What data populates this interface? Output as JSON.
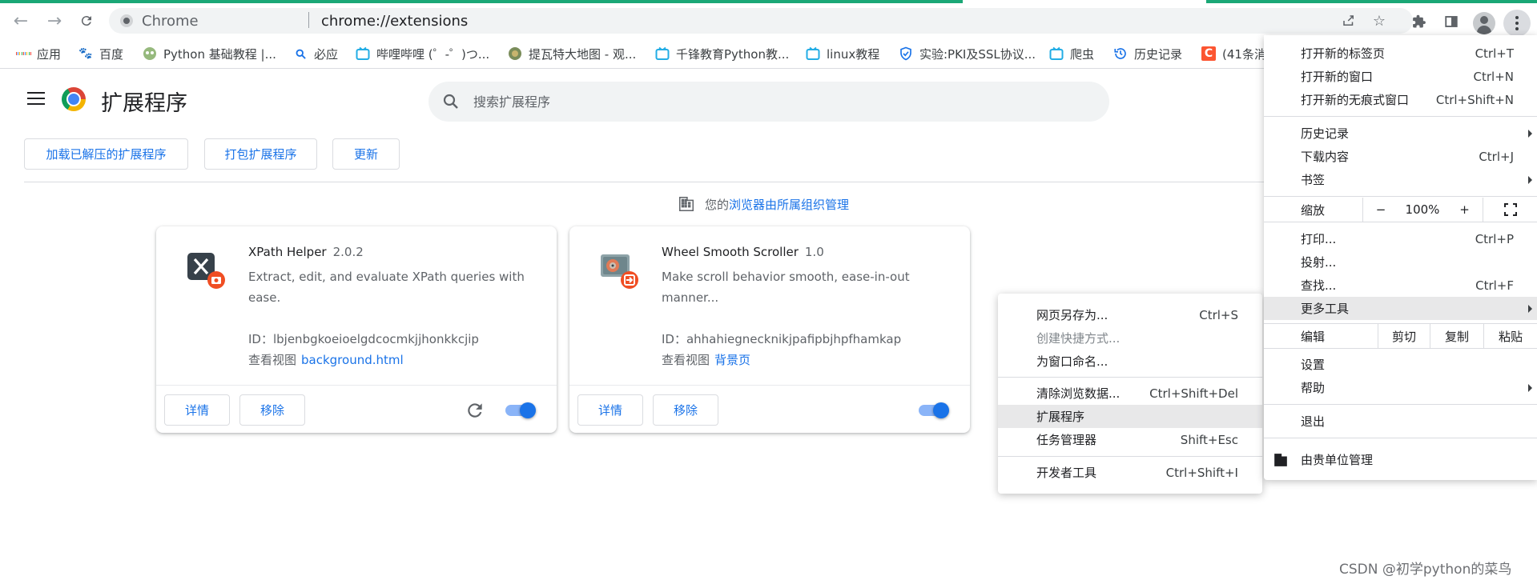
{
  "browser": {
    "url_prefix": "Chrome",
    "url_path": "chrome://extensions",
    "colors": {
      "loading_bar": "#1aa776",
      "accent": "#1a73e8"
    }
  },
  "bookmarks": [
    {
      "label": "应用",
      "icon": "apps-grid-icon"
    },
    {
      "label": "百度",
      "icon": "baidu-paw-icon"
    },
    {
      "label": "Python 基础教程 |...",
      "icon": "runoob-icon"
    },
    {
      "label": "必应",
      "icon": "bing-search-icon"
    },
    {
      "label": "哔哩哔哩 (゜-゜)つ...",
      "icon": "bilibili-tv-icon"
    },
    {
      "label": "提瓦特大地图 - 观...",
      "icon": "genshin-map-icon"
    },
    {
      "label": "千锋教育Python教...",
      "icon": "bilibili-tv-icon"
    },
    {
      "label": "linux教程",
      "icon": "bilibili-tv-icon"
    },
    {
      "label": "实验:PKI及SSL协议...",
      "icon": "shield-check-icon"
    },
    {
      "label": "爬虫",
      "icon": "bilibili-tv-icon"
    },
    {
      "label": "历史记录",
      "icon": "history-icon"
    },
    {
      "label": "(41条消",
      "icon": "csdn-c-icon"
    }
  ],
  "header": {
    "title": "扩展程序",
    "search_placeholder": "搜索扩展程序"
  },
  "actions": {
    "load_unpacked": "加载已解压的扩展程序",
    "pack": "打包扩展程序",
    "update": "更新"
  },
  "managed": {
    "prefix": "您的",
    "link": "浏览器由所属组织管理"
  },
  "extensions": [
    {
      "name": "XPath Helper",
      "version": "2.0.2",
      "description": "Extract, edit, and evaluate XPath queries with ease.",
      "id_line": "ID：lbjenbgkoeioelgdcocmkjjhonkkcjip",
      "view_label": "查看视图",
      "view_link": "background.html",
      "details": "详情",
      "remove": "移除",
      "enabled": true
    },
    {
      "name": "Wheel Smooth Scroller",
      "version": "1.0",
      "description": "Make scroll behavior smooth, ease-in-out manner...",
      "id_line": "ID：ahhahiegnecknikjpafipbjhpfhamkap",
      "view_label": "查看视图",
      "view_link": "背景页",
      "details": "详情",
      "remove": "移除",
      "enabled": true
    }
  ],
  "main_menu": {
    "new_tab": {
      "label": "打开新的标签页",
      "shortcut": "Ctrl+T"
    },
    "new_window": {
      "label": "打开新的窗口",
      "shortcut": "Ctrl+N"
    },
    "incognito": {
      "label": "打开新的无痕式窗口",
      "shortcut": "Ctrl+Shift+N"
    },
    "history": {
      "label": "历史记录"
    },
    "downloads": {
      "label": "下载内容",
      "shortcut": "Ctrl+J"
    },
    "bookmarks": {
      "label": "书签"
    },
    "zoom": {
      "label": "缩放",
      "minus": "−",
      "value": "100%",
      "plus": "+"
    },
    "print": {
      "label": "打印...",
      "shortcut": "Ctrl+P"
    },
    "cast": {
      "label": "投射..."
    },
    "find": {
      "label": "查找...",
      "shortcut": "Ctrl+F"
    },
    "more_tools": {
      "label": "更多工具"
    },
    "edit": {
      "label": "编辑",
      "cut": "剪切",
      "copy": "复制",
      "paste": "粘贴"
    },
    "settings": {
      "label": "设置"
    },
    "help": {
      "label": "帮助"
    },
    "exit": {
      "label": "退出"
    },
    "managed": {
      "label": "由贵单位管理"
    }
  },
  "submenu": {
    "save_as": {
      "label": "网页另存为...",
      "shortcut": "Ctrl+S"
    },
    "create_shortcut": {
      "label": "创建快捷方式..."
    },
    "name_window": {
      "label": "为窗口命名..."
    },
    "clear_data": {
      "label": "清除浏览数据...",
      "shortcut": "Ctrl+Shift+Del"
    },
    "extensions": {
      "label": "扩展程序"
    },
    "task_manager": {
      "label": "任务管理器",
      "shortcut": "Shift+Esc"
    },
    "dev_tools": {
      "label": "开发者工具",
      "shortcut": "Ctrl+Shift+I"
    }
  },
  "watermark": "CSDN @初学python的菜鸟"
}
